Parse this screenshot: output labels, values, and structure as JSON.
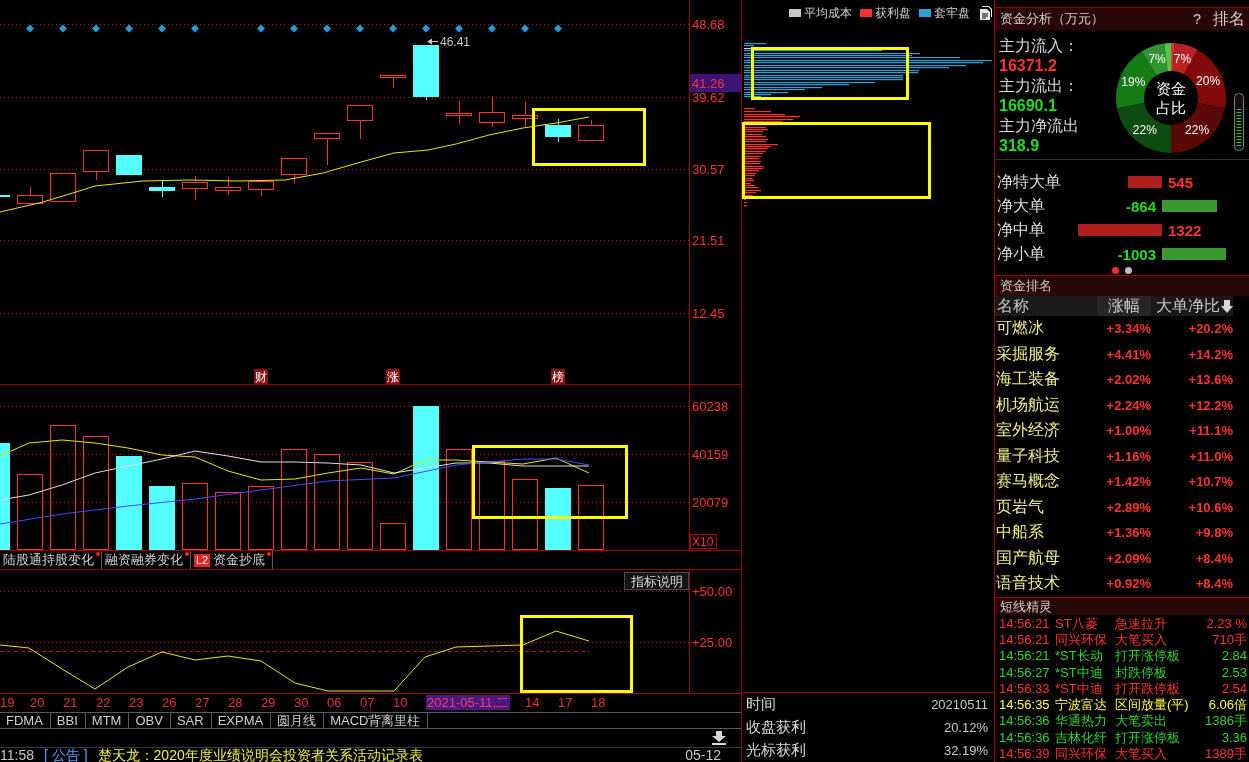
{
  "price_chart": {
    "axis_labels": [
      "48.68",
      "39.62",
      "30.57",
      "21.51",
      "12.45"
    ],
    "current_price": "41.26",
    "peak_label": "46.41",
    "event_markers": [
      {
        "label": "财"
      },
      {
        "label": "涨"
      },
      {
        "label": "榜"
      }
    ]
  },
  "volume_chart": {
    "axis_labels": [
      "60238",
      "40159",
      "20079"
    ],
    "unit": "X10"
  },
  "data_tabs": [
    {
      "label": "陆股通持股变化",
      "has_update": true,
      "selected": false
    },
    {
      "label": "融资融券变化",
      "has_update": true,
      "selected": false
    },
    {
      "badge": "L2",
      "label": "资金抄底",
      "has_update": true,
      "selected": false
    }
  ],
  "indicator_chart": {
    "help_button": "指标说明",
    "axis_labels": [
      "+50.00",
      "+25.00"
    ]
  },
  "dates": [
    {
      "label": "19",
      "selected": false
    },
    {
      "label": "20",
      "selected": false
    },
    {
      "label": "21",
      "selected": false
    },
    {
      "label": "22",
      "selected": false
    },
    {
      "label": "23",
      "selected": false
    },
    {
      "label": "26",
      "selected": false
    },
    {
      "label": "27",
      "selected": false
    },
    {
      "label": "28",
      "selected": false
    },
    {
      "label": "29",
      "selected": false
    },
    {
      "label": "30",
      "selected": false
    },
    {
      "label": "06",
      "selected": false
    },
    {
      "label": "07",
      "selected": false
    },
    {
      "label": "10",
      "selected": false
    },
    {
      "label": "2021-05-11,二",
      "selected": true
    },
    {
      "label": "14",
      "selected": false
    },
    {
      "label": "17",
      "selected": false
    },
    {
      "label": "18",
      "selected": false
    }
  ],
  "indicator_tabs": [
    {
      "label": "FDMA",
      "selected": false
    },
    {
      "label": "BBI",
      "selected": false
    },
    {
      "label": "MTM",
      "selected": false
    },
    {
      "label": "OBV",
      "selected": false
    },
    {
      "label": "SAR",
      "selected": false
    },
    {
      "label": "EXPMA",
      "selected": false
    },
    {
      "label": "圆月线",
      "selected": false
    },
    {
      "label": "MACD背离里柱",
      "selected": false
    }
  ],
  "news_ticker": {
    "time": "11:58",
    "category": "[ 公告 ]",
    "headline": "楚天龙：2020年度业绩说明会投资者关系活动记录表",
    "date": "05-12"
  },
  "chip_panel": {
    "legend": [
      {
        "kind": "average",
        "label": "平均成本",
        "color": "#c8c8c8"
      },
      {
        "kind": "profit",
        "label": "获利盘",
        "color": "#ff3030"
      },
      {
        "kind": "trapped",
        "label": "套牢盘",
        "color": "#2a9fd8"
      }
    ],
    "stats": [
      {
        "label": "时间",
        "value": "20210511"
      },
      {
        "label": "收盘获利",
        "value": "20.12%"
      },
      {
        "label": "光标获利",
        "value": "32.19%"
      }
    ]
  },
  "fund_analysis": {
    "title": "资金分析（万元）",
    "help": "?",
    "ranking_link": "排名",
    "flows": [
      {
        "label": "主力流入：",
        "value": "16371.2",
        "kind": "inflow"
      },
      {
        "label": "主力流出：",
        "value": "16690.1",
        "kind": "outflow"
      },
      {
        "label": "主力净流出",
        "value": "318.9",
        "kind": "outflow"
      }
    ],
    "chart_data": {
      "type": "donut",
      "title": "资金占比",
      "values": [
        1,
        7,
        20,
        22,
        22,
        19,
        7,
        2
      ],
      "value_labels": [
        null,
        "7%",
        "20%",
        "22%",
        "22%",
        "19%",
        "7%",
        null
      ],
      "colors": [
        "#e83232",
        "#b82222",
        "#820a0a",
        "#5a0808",
        "#0c4c10",
        "#147a14",
        "#2f942f",
        "#4cc84c"
      ]
    },
    "net_orders": [
      {
        "label": "净特大单",
        "value": "545",
        "kind": "inflow",
        "level": 0.41
      },
      {
        "label": "净大单",
        "value": "-864",
        "kind": "outflow",
        "level": 0.65
      },
      {
        "label": "净中单",
        "value": "1322",
        "kind": "inflow",
        "level": 1
      },
      {
        "label": "净小单",
        "value": "-1003",
        "kind": "outflow",
        "level": 0.76
      }
    ],
    "pages": [
      {
        "selected": true
      },
      {
        "selected": false
      }
    ]
  },
  "fund_ranking": {
    "title": "资金排名",
    "columns": [
      {
        "label": "名称",
        "sort_descending": false
      },
      {
        "label": "涨幅",
        "sort_descending": false
      },
      {
        "label": "大单净比",
        "sort_descending": true
      }
    ],
    "rows": [
      {
        "name": "可燃冰",
        "change": "+3.34%",
        "net_ratio": "+20.2%"
      },
      {
        "name": "采掘服务",
        "change": "+4.41%",
        "net_ratio": "+14.2%"
      },
      {
        "name": "海工装备",
        "change": "+2.02%",
        "net_ratio": "+13.6%"
      },
      {
        "name": "机场航运",
        "change": "+2.24%",
        "net_ratio": "+12.2%"
      },
      {
        "name": "室外经济",
        "change": "+1.00%",
        "net_ratio": "+11.1%"
      },
      {
        "name": "量子科技",
        "change": "+1.16%",
        "net_ratio": "+11.0%"
      },
      {
        "name": "赛马概念",
        "change": "+1.42%",
        "net_ratio": "+10.7%"
      },
      {
        "name": "页岩气",
        "change": "+2.89%",
        "net_ratio": "+10.6%"
      },
      {
        "name": "中船系",
        "change": "+1.36%",
        "net_ratio": "+9.8%"
      },
      {
        "name": "国产航母",
        "change": "+2.09%",
        "net_ratio": "+8.4%"
      },
      {
        "name": "语音技术",
        "change": "+0.92%",
        "net_ratio": "+8.4%"
      }
    ]
  },
  "short_term_alerts": {
    "title": "短线精灵",
    "rows": [
      {
        "time": "14:56:21",
        "stock": "ST八菱",
        "event": "急速拉升",
        "value": "2.23 %",
        "color": "#ff3232"
      },
      {
        "time": "14:56:21",
        "stock": "同兴环保",
        "event": "大笔买入",
        "value": "710手",
        "color": "#ff3232"
      },
      {
        "time": "14:56:21",
        "stock": "*ST长动",
        "event": "打开涨停板",
        "value": "2.84",
        "color": "#32d232"
      },
      {
        "time": "14:56:27",
        "stock": "*ST中迪",
        "event": "封跌停板",
        "value": "2.53",
        "color": "#32d232"
      },
      {
        "time": "14:56:33",
        "stock": "*ST中迪",
        "event": "打开跌停板",
        "value": "2.54",
        "color": "#ff3232"
      },
      {
        "time": "14:56:35",
        "stock": "宁波富达",
        "event": "区间放量(平)",
        "value": "6.06倍",
        "color": "#ffff3c"
      },
      {
        "time": "14:56:36",
        "stock": "华通热力",
        "event": "大笔卖出",
        "value": "1386手",
        "color": "#32d232"
      },
      {
        "time": "14:56:36",
        "stock": "吉林化纤",
        "event": "打开涨停板",
        "value": "3.36",
        "color": "#32d232"
      },
      {
        "time": "14:56:39",
        "stock": "同兴环保",
        "event": "大笔买入",
        "value": "1389手",
        "color": "#ff3232"
      }
    ]
  }
}
